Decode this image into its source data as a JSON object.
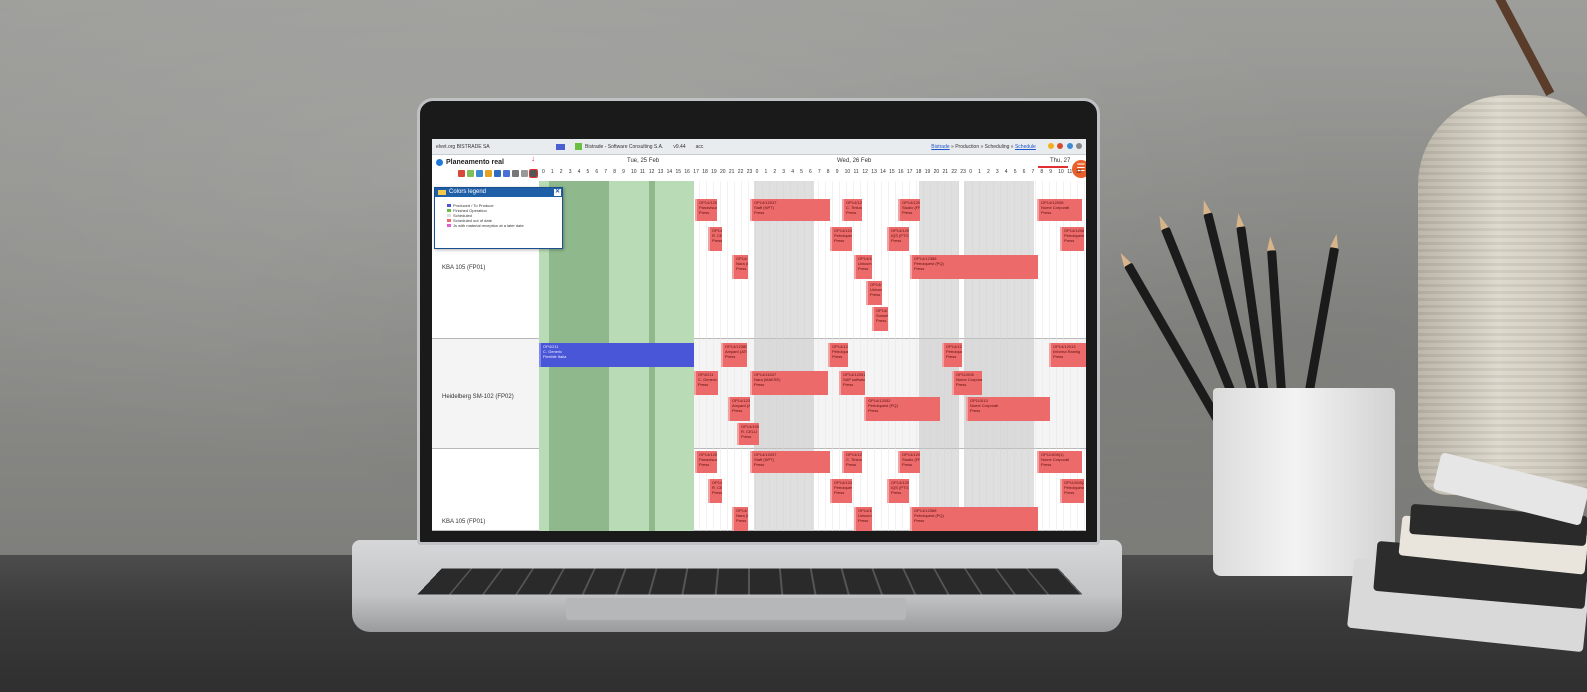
{
  "top_bar": {
    "company": "elvet.org BISTRADE SA",
    "app_name": "Bistrade - Software Consulting S.A.",
    "version": "v9.44",
    "user": "acc",
    "breadcrumb_root": "Bistrade",
    "breadcrumb_mid": "» Production » Scheduling »",
    "breadcrumb_current": "Schedule"
  },
  "page": {
    "title": "Planeamento real"
  },
  "days": [
    "Tue, 25 Feb",
    "Wed, 26 Feb",
    "Thu, 27"
  ],
  "hours": [
    "0",
    "1",
    "2",
    "3",
    "4",
    "5",
    "6",
    "7",
    "8",
    "9",
    "10",
    "11",
    "12",
    "13",
    "14",
    "15",
    "16",
    "17",
    "18",
    "19",
    "20",
    "21",
    "22",
    "23",
    "0",
    "1",
    "2",
    "3",
    "4",
    "5",
    "6",
    "7",
    "8",
    "9",
    "10",
    "11",
    "12",
    "13",
    "14",
    "15",
    "16",
    "17",
    "18",
    "19",
    "20",
    "21",
    "22",
    "23",
    "0",
    "1",
    "2",
    "3",
    "4",
    "5",
    "6",
    "7",
    "8",
    "9",
    "10",
    "11",
    "12"
  ],
  "legend": {
    "title": "Colors legend",
    "items": [
      {
        "label": "Produced / To Produce",
        "color": "#4a56d8"
      },
      {
        "label": "Finished Operation",
        "color": "#6bbf3f"
      },
      {
        "label": "Scheduled",
        "color": "#dddddd"
      },
      {
        "label": "Scheduled out of date",
        "color": "#ec6a6a"
      },
      {
        "label": "Js with material reception at a later date",
        "color": "#e060d0"
      }
    ]
  },
  "resources": [
    {
      "label": "KBA 105 (FP01)"
    },
    {
      "label": "Heidelberg SM-102 (FP02)"
    },
    {
      "label": "KBA 105 (FP01)"
    }
  ],
  "tasks": {
    "r1": [
      {
        "id": "OP14/12009",
        "client": "Panavisual (PDU)",
        "op": "Press"
      },
      {
        "id": "OP14/12037",
        "client": "Staff (NPT)",
        "op": "Press"
      },
      {
        "id": "OP14/12030",
        "client": "C. Tinturas",
        "op": "Press"
      },
      {
        "id": "OP14/12033",
        "client": "Studio (FRIG)",
        "op": "Press"
      },
      {
        "id": "OP14/12008",
        "client": "Nome Corporati",
        "op": "Press"
      },
      {
        "id": "OP14/12046",
        "client": "R. CELLI",
        "op": "Press"
      },
      {
        "id": "OP14/12420",
        "client": "Petrolquest (PQ)",
        "op": "Press"
      },
      {
        "id": "OP14/12013",
        "client": "IQS (PTG)",
        "op": "Press"
      },
      {
        "id": "OP14/12061",
        "client": "Petrolquest",
        "op": "Press"
      },
      {
        "id": "OP14/1209",
        "client": "Nara (Hybrid)",
        "op": "Press"
      },
      {
        "id": "OP14/10950",
        "client": "Unicum (UCP)",
        "op": "Press"
      },
      {
        "id": "OP14/12388",
        "client": "Petrolquest (PQ)",
        "op": "Press"
      },
      {
        "id": "OP14/10950",
        "client": "Unicum (UCP)",
        "op": "Press"
      },
      {
        "id": "OP14/12064",
        "client": "Sunset AI",
        "op": "Press"
      }
    ],
    "r2": [
      {
        "id": "OP4/211",
        "client": "C. Generic",
        "op": "Flexible Italia"
      },
      {
        "id": "OP14/12380(1)",
        "client": "Amyard (ATC)",
        "op": "Press"
      },
      {
        "id": "OP14/12421",
        "client": "Petrolquest (PQ)",
        "op": "Press"
      },
      {
        "id": "OP14/12564",
        "client": "Petrolquest (PQ)",
        "op": "Press"
      },
      {
        "id": "OP14/12013",
        "client": "Informa Ramlig",
        "op": "Press"
      },
      {
        "id": "OP4/211",
        "client": "C. Generic",
        "op": "Press"
      },
      {
        "id": "OP14/11637",
        "client": "Nara (MAKSE)",
        "op": "Press"
      },
      {
        "id": "OP14/12051",
        "client": "SAP software",
        "op": "Press"
      },
      {
        "id": "OP11/008",
        "client": "Nome Corporati",
        "op": "Press"
      },
      {
        "id": "OP14/12380(2)",
        "client": "Amyard (ATC)",
        "op": "Press"
      },
      {
        "id": "OP14/12052",
        "client": "Petrolquest (PQ)",
        "op": "Press"
      },
      {
        "id": "OP11/013",
        "client": "Nome Corporati",
        "op": "Press"
      },
      {
        "id": "OP14/10047",
        "client": "R. CELLI",
        "op": "Press"
      }
    ],
    "r3": [
      {
        "id": "OP14/12009",
        "client": "Panavisual (PDU)",
        "op": "Press"
      },
      {
        "id": "OP14/12037",
        "client": "Staff (NPT)",
        "op": "Press"
      },
      {
        "id": "OP14/12030",
        "client": "C. Tinturas",
        "op": "Press"
      },
      {
        "id": "OP14/12033",
        "client": "Studio (FRIG)",
        "op": "Press"
      },
      {
        "id": "OP11/008(1)",
        "client": "Nome Corporati",
        "op": "Press"
      },
      {
        "id": "OP14/12046",
        "client": "R. CELLI",
        "op": "Press"
      },
      {
        "id": "OP14/12420",
        "client": "Petrolquest (PQ)",
        "op": "Press"
      },
      {
        "id": "OP14/12013",
        "client": "IQS (PTG)",
        "op": "Press"
      },
      {
        "id": "OP11/008(2)",
        "client": "Petrolquest",
        "op": "Press"
      },
      {
        "id": "OP14/1209",
        "client": "Nara (MAKSE)",
        "op": "Press"
      },
      {
        "id": "OP14/10950",
        "client": "Unicum (UCP)",
        "op": "Press"
      },
      {
        "id": "OP14/12388",
        "client": "Petrolquest (PQ)",
        "op": "Press"
      }
    ]
  },
  "colors": {
    "scheduled_late": "#ec6a6a",
    "produced": "#4a56d8",
    "finished_zone": "#b9dbb5",
    "accent": "#1f5fa8"
  }
}
